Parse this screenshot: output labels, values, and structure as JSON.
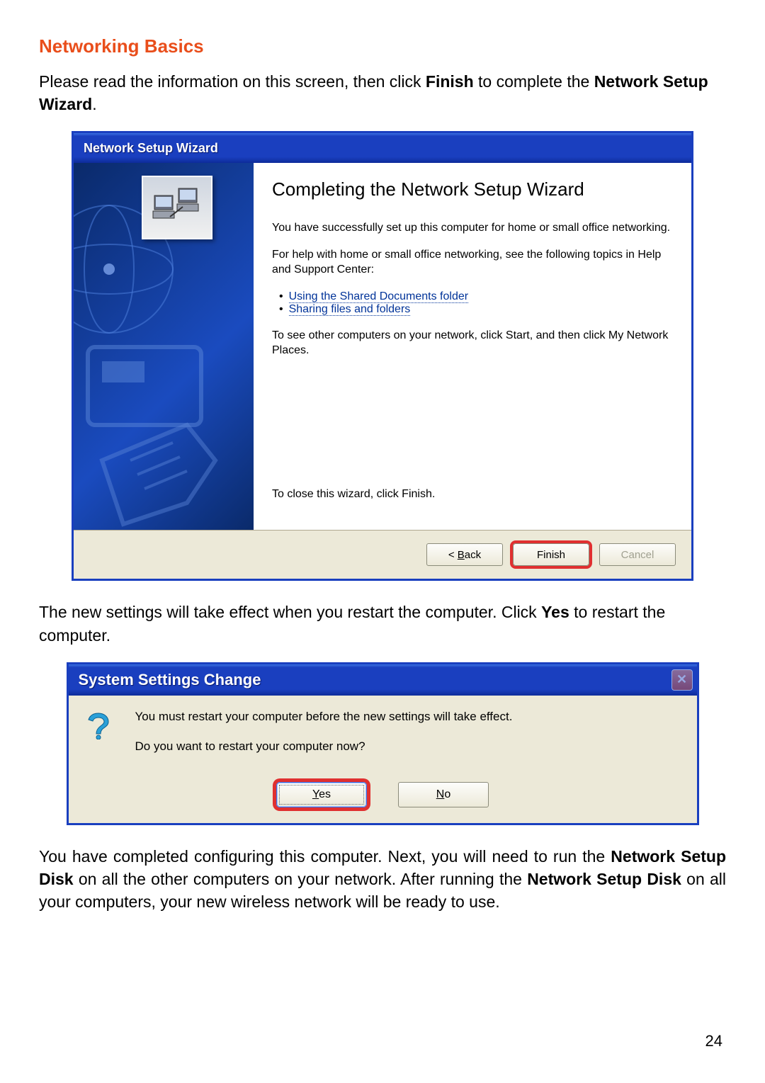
{
  "section_title": "Networking Basics",
  "intro": {
    "pre": "Please read the information on this screen, then click ",
    "bold1": "Finish",
    "mid": " to complete the ",
    "bold2": "Network Setup Wizard",
    "post": "."
  },
  "nsw": {
    "title": "Network Setup Wizard",
    "heading": "Completing the Network Setup Wizard",
    "p1": "You have successfully set up this computer for home or small office networking.",
    "p2": "For help with home or small office networking, see the following topics in Help and Support Center:",
    "links": {
      "l1": "Using the Shared Documents folder",
      "l2": "Sharing files and folders"
    },
    "p3": "To see other computers on your network, click Start, and then click My Network Places.",
    "close_hint": "To close this wizard, click Finish.",
    "buttons": {
      "back": "< Back",
      "finish": "Finish",
      "cancel": "Cancel"
    }
  },
  "mid": {
    "pre": "The new settings will take effect when you restart the computer.  Click ",
    "bold": "Yes",
    "post": " to restart the computer."
  },
  "ssc": {
    "title": "System Settings Change",
    "p1": "You must restart your computer before the new settings will take effect.",
    "p2": "Do you want to restart your computer now?",
    "buttons": {
      "yes": "Yes",
      "no": "No"
    }
  },
  "outro": {
    "t1": "You have completed configuring this computer.  Next, you will need to run the ",
    "b1": "Network Setup Disk",
    "t2": " on all the other computers on your network.  After running the ",
    "b2": "Network Setup Disk",
    "t3": " on all your computers, your new wireless network will be ready to use."
  },
  "page_number": "24"
}
